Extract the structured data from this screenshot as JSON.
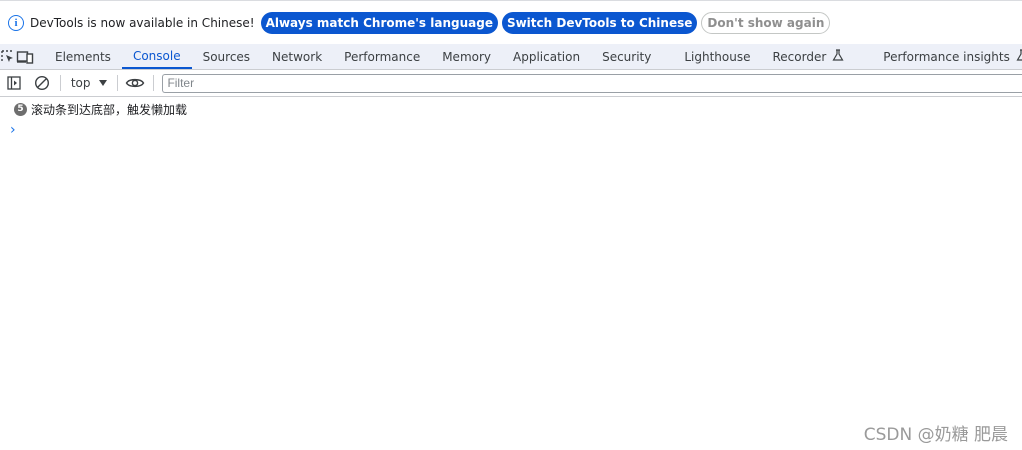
{
  "infobar": {
    "message": "DevTools is now available in Chinese!",
    "buttons": {
      "match_language": "Always match Chrome's language",
      "switch_chinese": "Switch DevTools to Chinese",
      "dont_show": "Don't show again"
    },
    "colors": {
      "primary": "#0b57d0",
      "info": "#1a73e8"
    }
  },
  "tabs": [
    {
      "label": "Elements"
    },
    {
      "label": "Console"
    },
    {
      "label": "Sources"
    },
    {
      "label": "Network"
    },
    {
      "label": "Performance"
    },
    {
      "label": "Memory"
    },
    {
      "label": "Application"
    },
    {
      "label": "Security"
    },
    {
      "label": "Lighthouse"
    },
    {
      "label": "Recorder"
    },
    {
      "label": "Performance insights"
    }
  ],
  "active_tab": "Console",
  "toolbar": {
    "context": "top",
    "filter_placeholder": "Filter"
  },
  "console": {
    "messages": [
      {
        "repeat_count": "5",
        "text": "滚动条到达底部，触发懒加载"
      }
    ],
    "prompt_symbol": "›"
  },
  "watermark": "CSDN @奶糖 肥晨"
}
